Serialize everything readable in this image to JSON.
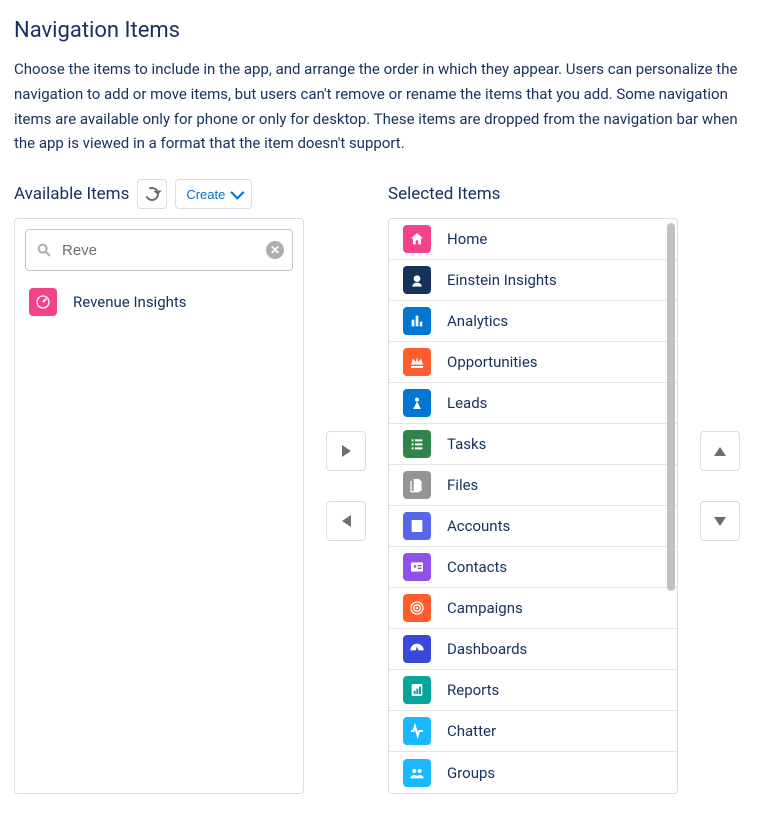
{
  "page": {
    "title": "Navigation Items",
    "description": "Choose the items to include in the app, and arrange the order in which they appear. Users can personalize the navigation to add or move items, but users can't remove or rename the items that you add. Some navigation items are available only for phone or only for desktop. These items are dropped from the navigation bar when the app is viewed in a format that the item doesn't support."
  },
  "available": {
    "heading": "Available Items",
    "create_label": "Create",
    "search_value": "Reve",
    "items": [
      {
        "label": "Revenue Insights",
        "icon": "gauge",
        "color": "#f2438a"
      }
    ]
  },
  "selected": {
    "heading": "Selected Items",
    "items": [
      {
        "label": "Home",
        "icon": "home",
        "color": "#f2438a"
      },
      {
        "label": "Einstein Insights",
        "icon": "einstein",
        "color": "#16325c"
      },
      {
        "label": "Analytics",
        "icon": "chart",
        "color": "#0176d3"
      },
      {
        "label": "Opportunities",
        "icon": "crown",
        "color": "#ff5d2d"
      },
      {
        "label": "Leads",
        "icon": "star",
        "color": "#0176d3"
      },
      {
        "label": "Tasks",
        "icon": "tasks",
        "color": "#2e844a"
      },
      {
        "label": "Files",
        "icon": "files",
        "color": "#969492"
      },
      {
        "label": "Accounts",
        "icon": "building",
        "color": "#5867e8"
      },
      {
        "label": "Contacts",
        "icon": "id",
        "color": "#9050e9"
      },
      {
        "label": "Campaigns",
        "icon": "target",
        "color": "#ff5d2d"
      },
      {
        "label": "Dashboards",
        "icon": "dash",
        "color": "#3a49da"
      },
      {
        "label": "Reports",
        "icon": "report",
        "color": "#06a59a"
      },
      {
        "label": "Chatter",
        "icon": "pulse",
        "color": "#1ab9ff"
      },
      {
        "label": "Groups",
        "icon": "groups",
        "color": "#1ab9ff"
      }
    ]
  }
}
